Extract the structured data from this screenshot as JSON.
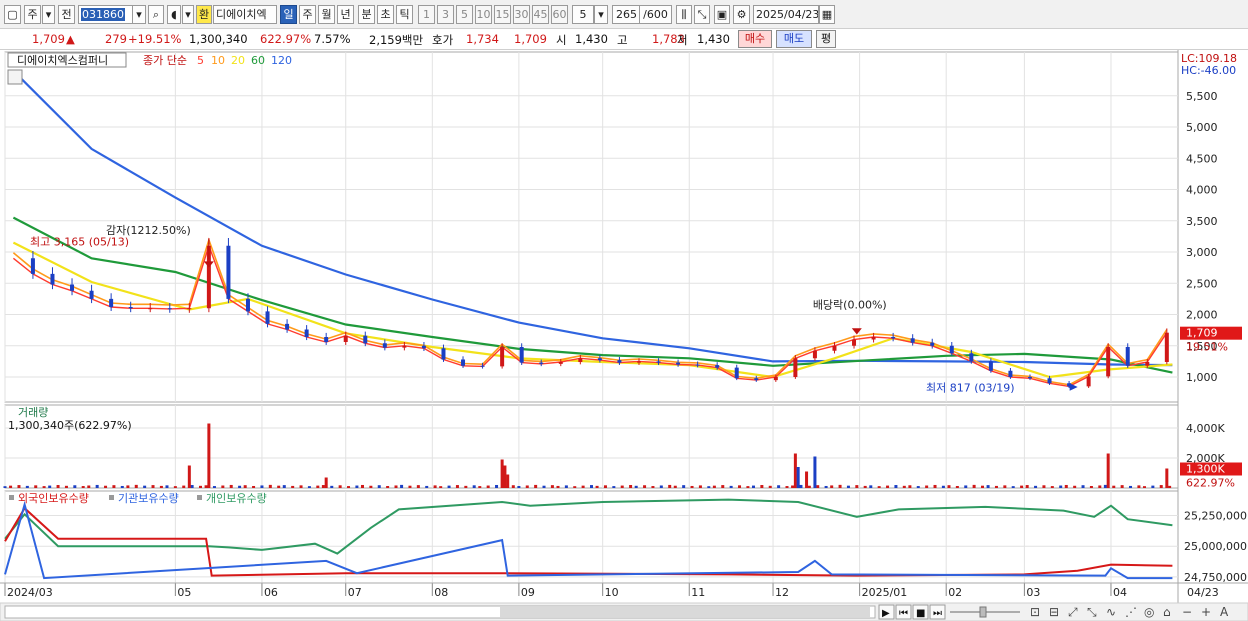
{
  "toolbar": {
    "period_unit": "주",
    "prev_label": "전",
    "code": "031860",
    "exchange_badge": "환",
    "stock_name": "디에이치엑",
    "tabs": [
      "일",
      "주",
      "월",
      "년",
      "분",
      "초",
      "틱"
    ],
    "active_tab": "일",
    "minute_options": [
      "1",
      "3",
      "5",
      "10",
      "15",
      "30",
      "45",
      "60"
    ],
    "minute_select": "5",
    "count": "265",
    "count_max": "/600",
    "date": "2025/04/23"
  },
  "quote": {
    "price": "1,709",
    "change_arrow": "▲",
    "change": "279",
    "change_pct": "+19.51%",
    "volume": "1,300,340",
    "volume_ratio": "622.97%",
    "turnover": "7.57%",
    "amount": "2,159백만",
    "ask_label": "호가",
    "ask": "1,734",
    "bid": "1,709",
    "open_label": "시",
    "open": "1,430",
    "high_label": "고",
    "high": "1,783",
    "low_label": "저",
    "low": "1,430",
    "buy_label": "매수",
    "sell_label": "매도",
    "avg_label": "평"
  },
  "colors": {
    "up": "#d01818",
    "down": "#1b3fc4",
    "ma5": "#ff3b2f",
    "ma10": "#ff9a1a",
    "ma20": "#f2e21a",
    "ma60": "#1f9a3a",
    "ma120": "#2f64e0",
    "foreign": "#d61818",
    "institution": "#2f64e0",
    "individual": "#2f9a62",
    "grid": "#e2e2e2"
  },
  "chart_data": [
    {
      "type": "candlestick",
      "title": "디에이치엑스컴퍼니",
      "legend_label": "종가 단순",
      "legend_periods": [
        "5",
        "10",
        "20",
        "60",
        "120"
      ],
      "ylim": [
        600,
        6200
      ],
      "y_ticks": [
        "1,000",
        "1,500",
        "2,000",
        "2,500",
        "3,000",
        "3,500",
        "4,000",
        "4,500",
        "5,000",
        "5,500"
      ],
      "lc_label": "LC:109.18",
      "hc_label": "HC:-46.00",
      "last_price": "1,709",
      "last_change_pct": "19.51%",
      "annotations": {
        "high": "최고 3,165 (05/13)",
        "gap": "감자(1212.50%)",
        "dividend": "배당락(0.00%)",
        "low": "최저 817 (03/19)"
      },
      "price_points": [
        [
          "2024-03-04",
          2900
        ],
        [
          "2024-03-11",
          2650
        ],
        [
          "2024-03-18",
          2480
        ],
        [
          "2024-03-25",
          2380
        ],
        [
          "2024-04-01",
          2250
        ],
        [
          "2024-04-08",
          2120
        ],
        [
          "2024-04-15",
          2100
        ],
        [
          "2024-04-22",
          2100
        ],
        [
          "2024-04-29",
          2090
        ],
        [
          "2024-05-06",
          2100
        ],
        [
          "2024-05-13",
          3100
        ],
        [
          "2024-05-20",
          2250
        ],
        [
          "2024-05-27",
          2050
        ],
        [
          "2024-06-03",
          1850
        ],
        [
          "2024-06-10",
          1760
        ],
        [
          "2024-06-17",
          1640
        ],
        [
          "2024-06-24",
          1560
        ],
        [
          "2024-07-01",
          1660
        ],
        [
          "2024-07-08",
          1540
        ],
        [
          "2024-07-15",
          1470
        ],
        [
          "2024-07-22",
          1500
        ],
        [
          "2024-07-29",
          1460
        ],
        [
          "2024-08-05",
          1280
        ],
        [
          "2024-08-12",
          1180
        ],
        [
          "2024-08-19",
          1170
        ],
        [
          "2024-08-26",
          1480
        ],
        [
          "2024-09-02",
          1230
        ],
        [
          "2024-09-09",
          1210
        ],
        [
          "2024-09-16",
          1240
        ],
        [
          "2024-09-23",
          1300
        ],
        [
          "2024-09-30",
          1270
        ],
        [
          "2024-10-07",
          1230
        ],
        [
          "2024-10-14",
          1250
        ],
        [
          "2024-10-21",
          1230
        ],
        [
          "2024-10-28",
          1200
        ],
        [
          "2024-11-04",
          1190
        ],
        [
          "2024-11-11",
          1150
        ],
        [
          "2024-11-18",
          980
        ],
        [
          "2024-11-25",
          950
        ],
        [
          "2024-12-02",
          1000
        ],
        [
          "2024-12-09",
          1300
        ],
        [
          "2024-12-16",
          1420
        ],
        [
          "2024-12-23",
          1500
        ],
        [
          "2024-12-30",
          1600
        ],
        [
          "2025-01-06",
          1640
        ],
        [
          "2025-01-13",
          1620
        ],
        [
          "2025-01-20",
          1550
        ],
        [
          "2025-01-27",
          1500
        ],
        [
          "2025-02-03",
          1380
        ],
        [
          "2025-02-10",
          1250
        ],
        [
          "2025-02-17",
          1100
        ],
        [
          "2025-02-24",
          1000
        ],
        [
          "2025-03-03",
          980
        ],
        [
          "2025-03-10",
          900
        ],
        [
          "2025-03-17",
          850
        ],
        [
          "2025-03-24",
          1010
        ],
        [
          "2025-03-31",
          1480
        ],
        [
          "2025-04-07",
          1180
        ],
        [
          "2025-04-14",
          1240
        ],
        [
          "2025-04-21",
          1709
        ]
      ],
      "ma120_points": [
        [
          "2024-03-04",
          5900
        ],
        [
          "2024-04-01",
          4650
        ],
        [
          "2024-05-01",
          3870
        ],
        [
          "2024-06-01",
          3100
        ],
        [
          "2024-07-01",
          2640
        ],
        [
          "2024-08-01",
          2240
        ],
        [
          "2024-09-01",
          1870
        ],
        [
          "2024-10-01",
          1620
        ],
        [
          "2024-11-01",
          1460
        ],
        [
          "2024-12-01",
          1250
        ],
        [
          "2025-01-01",
          1260
        ],
        [
          "2025-02-01",
          1250
        ],
        [
          "2025-03-01",
          1240
        ],
        [
          "2025-04-01",
          1200
        ],
        [
          "2025-04-23",
          1190
        ]
      ],
      "ma60_points": [
        [
          "2024-03-04",
          3550
        ],
        [
          "2024-04-01",
          2900
        ],
        [
          "2024-05-01",
          2680
        ],
        [
          "2024-06-01",
          2230
        ],
        [
          "2024-07-01",
          1840
        ],
        [
          "2024-08-01",
          1640
        ],
        [
          "2024-09-01",
          1450
        ],
        [
          "2024-10-01",
          1350
        ],
        [
          "2024-11-01",
          1300
        ],
        [
          "2024-12-01",
          1180
        ],
        [
          "2025-01-01",
          1260
        ],
        [
          "2025-02-01",
          1340
        ],
        [
          "2025-03-01",
          1370
        ],
        [
          "2025-04-01",
          1280
        ],
        [
          "2025-04-23",
          1070
        ]
      ],
      "ma20_points": [
        [
          "2024-03-04",
          3150
        ],
        [
          "2024-04-01",
          2520
        ],
        [
          "2024-05-06",
          2080
        ],
        [
          "2024-05-27",
          2250
        ],
        [
          "2024-07-01",
          1700
        ],
        [
          "2024-08-01",
          1480
        ],
        [
          "2024-09-01",
          1300
        ],
        [
          "2024-10-01",
          1240
        ],
        [
          "2024-11-01",
          1190
        ],
        [
          "2024-12-01",
          1000
        ],
        [
          "2024-12-23",
          1300
        ],
        [
          "2025-01-13",
          1620
        ],
        [
          "2025-02-10",
          1400
        ],
        [
          "2025-03-10",
          1000
        ],
        [
          "2025-03-31",
          1120
        ],
        [
          "2025-04-23",
          1200
        ]
      ],
      "volume_panel": {
        "title": "거래량",
        "label": "1,300,340주(622.97%)",
        "ylim": [
          0,
          5000
        ],
        "y_ticks": [
          "2,000K",
          "4,000K"
        ],
        "last_label": "1,300K",
        "last_pct": "622.97%",
        "spikes": [
          [
            "2024-05-13",
            4300,
            "up"
          ],
          [
            "2024-05-06",
            1500,
            "up"
          ],
          [
            "2024-06-24",
            700,
            "up"
          ],
          [
            "2024-08-26",
            1900,
            "up"
          ],
          [
            "2024-08-27",
            1500,
            "up"
          ],
          [
            "2024-08-28",
            900,
            "up"
          ],
          [
            "2024-12-09",
            2300,
            "up"
          ],
          [
            "2024-12-10",
            1400,
            "down"
          ],
          [
            "2024-12-16",
            2100,
            "down"
          ],
          [
            "2024-12-13",
            1100,
            "up"
          ],
          [
            "2025-03-31",
            2300,
            "up"
          ],
          [
            "2025-04-21",
            1300,
            "up"
          ]
        ]
      },
      "holding_panel": {
        "series_labels": [
          "외국인보유수량",
          "기관보유수량",
          "개인보유수량"
        ],
        "ylim": [
          24700000,
          25450000
        ],
        "y_ticks": [
          "24,750,000",
          "25,000,000",
          "25,250,000"
        ]
      },
      "x_ticks": [
        "2024/03",
        "05",
        "06",
        "07",
        "08",
        "09",
        "10",
        "11",
        "12",
        "2025/01",
        "02",
        "03",
        "04"
      ],
      "x_right_label": "04/23"
    }
  ]
}
